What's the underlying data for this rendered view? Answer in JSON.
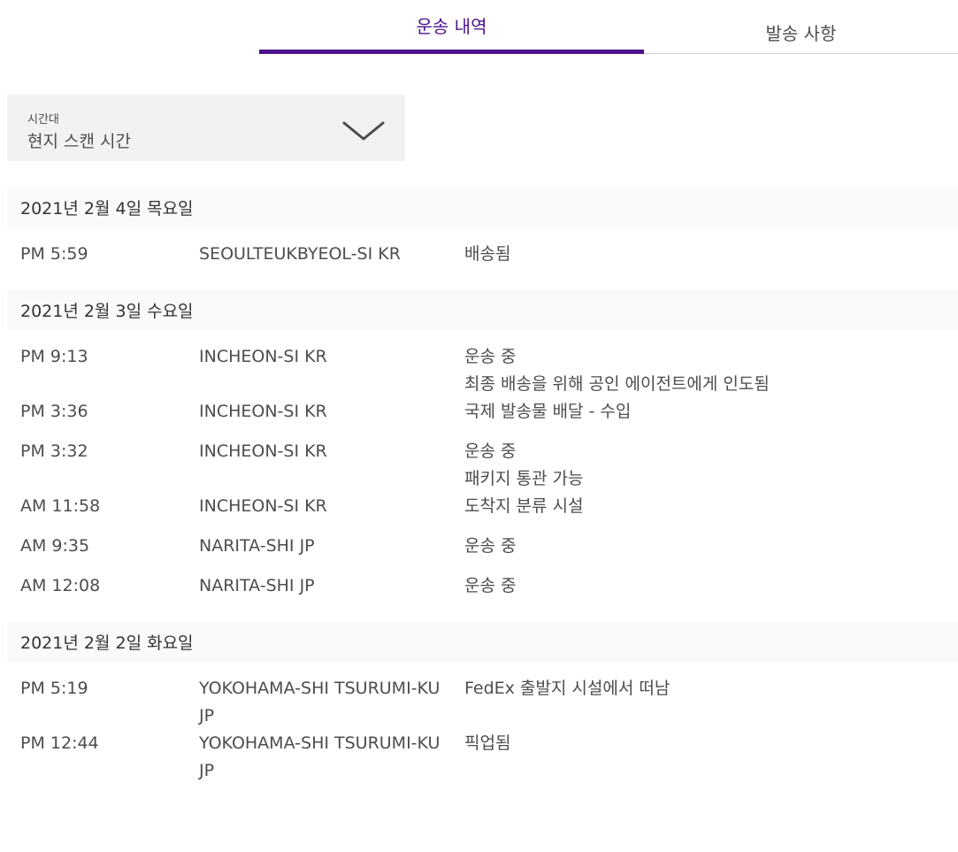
{
  "tabs": {
    "history_label": "운송 내역",
    "details_label": "발송 사항",
    "accent_color": "#4d148c"
  },
  "timezone": {
    "label": "시간대",
    "value": "현지 스캔 시간",
    "icon": "chevron-down-icon"
  },
  "days": [
    {
      "date": "2021년 2월 4일 목요일",
      "events": [
        {
          "time": "PM 5:59",
          "location": "SEOULTEUKBYEOL-SI KR",
          "status": [
            "배송됨"
          ]
        }
      ]
    },
    {
      "date": "2021년 2월 3일 수요일",
      "events": [
        {
          "time": "PM 9:13",
          "location": "INCHEON-SI KR",
          "status": [
            "운송 중",
            "최종 배송을 위해 공인 에이전트에게 인도됨"
          ]
        },
        {
          "time": "PM 3:36",
          "location": "INCHEON-SI KR",
          "status": [
            "국제 발송물 배달 - 수입"
          ]
        },
        {
          "time": "PM 3:32",
          "location": "INCHEON-SI KR",
          "status": [
            "운송 중",
            "패키지 통관 가능"
          ]
        },
        {
          "time": "AM 11:58",
          "location": "INCHEON-SI KR",
          "status": [
            "도착지 분류 시설"
          ]
        },
        {
          "time": "AM 9:35",
          "location": "NARITA-SHI JP",
          "status": [
            "운송 중"
          ]
        },
        {
          "time": "AM 12:08",
          "location": "NARITA-SHI JP",
          "status": [
            "운송 중"
          ]
        }
      ]
    },
    {
      "date": "2021년 2월 2일 화요일",
      "events": [
        {
          "time": "PM 5:19",
          "location": "YOKOHAMA-SHI TSURUMI-KU JP",
          "status": [
            "FedEx 출발지 시설에서 떠남"
          ]
        },
        {
          "time": "PM 12:44",
          "location": "YOKOHAMA-SHI TSURUMI-KU JP",
          "status": [
            "픽업됨"
          ]
        }
      ]
    }
  ]
}
